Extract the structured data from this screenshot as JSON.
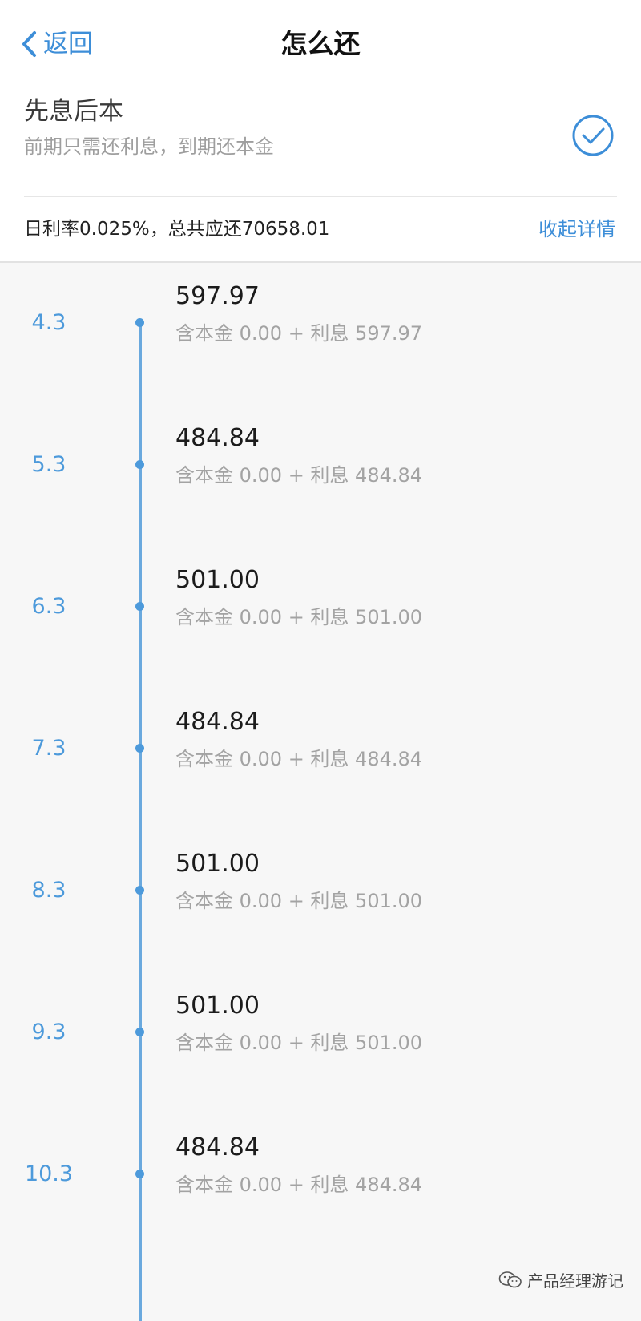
{
  "nav": {
    "back_label": "返回",
    "title": "怎么还"
  },
  "plan": {
    "name": "先息后本",
    "description": "前期只需还利息，到期还本金",
    "selected": true,
    "check_icon": "check-circle-icon"
  },
  "summary": {
    "text": "日利率0.025%，总共应还70658.01",
    "collapse_label": "收起详情"
  },
  "schedule": [
    {
      "date": "4.3",
      "amount": "597.97",
      "detail": "含本金 0.00 + 利息 597.97"
    },
    {
      "date": "5.3",
      "amount": "484.84",
      "detail": "含本金 0.00 + 利息 484.84"
    },
    {
      "date": "6.3",
      "amount": "501.00",
      "detail": "含本金 0.00 + 利息 501.00"
    },
    {
      "date": "7.3",
      "amount": "484.84",
      "detail": "含本金 0.00 + 利息 484.84"
    },
    {
      "date": "8.3",
      "amount": "501.00",
      "detail": "含本金 0.00 + 利息 501.00"
    },
    {
      "date": "9.3",
      "amount": "501.00",
      "detail": "含本金 0.00 + 利息 501.00"
    },
    {
      "date": "10.3",
      "amount": "484.84",
      "detail": "含本金 0.00 + 利息 484.84"
    }
  ],
  "watermark": {
    "text": "产品经理游记",
    "icon": "wechat-icon"
  },
  "colors": {
    "accent": "#3d8ed8",
    "timeline": "#4d9adb"
  }
}
